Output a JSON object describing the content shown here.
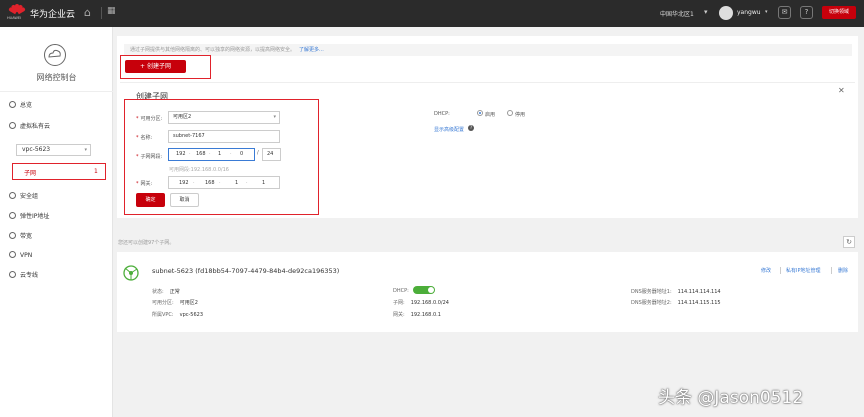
{
  "topbar": {
    "brand": "华为企业云",
    "logo_text": "HUAWEI",
    "region": "中国华北区1",
    "user": "yangwu",
    "red_button": "切换领域"
  },
  "sidebar": {
    "title": "网络控制台",
    "items": [
      {
        "label": "总览",
        "icon": "overview-icon"
      },
      {
        "label": "虚拟私有云",
        "icon": "vpc-icon"
      },
      {
        "label": "安全组",
        "icon": "security-group-icon"
      },
      {
        "label": "弹性IP地址",
        "icon": "eip-icon"
      },
      {
        "label": "带宽",
        "icon": "bandwidth-icon"
      },
      {
        "label": "VPN",
        "icon": "vpn-icon"
      },
      {
        "label": "云专线",
        "icon": "direct-connect-icon"
      }
    ],
    "vpc_select": "vpc-5623",
    "subnet_label": "子网",
    "subnet_count": "1"
  },
  "main": {
    "info_text": "通过子网提供与其他网络隔离的、可以独享的网络资源，以提高网络安全。",
    "info_link": "了解更多...",
    "create_button": "创建子网",
    "form": {
      "title": "创建子网",
      "az_label": "可用分区:",
      "az_value": "可用区2",
      "name_label": "名称:",
      "name_value": "subnet-7167",
      "cidr_label": "子网网段:",
      "cidr": [
        "192",
        "168",
        "1",
        "0"
      ],
      "cidr_mask": "24",
      "cidr_hint": "可用网段:192.168.0.0/16",
      "gateway_label": "网关:",
      "gateway": [
        "192",
        "168",
        "1",
        "1"
      ],
      "dhcp_label": "DHCP:",
      "dhcp_on": "启用",
      "dhcp_off": "停用",
      "advanced_link": "显示高级配置",
      "ok_button": "确定",
      "cancel_button": "取消"
    },
    "list_count_text": "您还可以创建97个子网。",
    "subnet_row": {
      "name": "subnet-5623",
      "id": "(fd18bb54-7097-4479-84b4-de92ca196353)",
      "status_label": "状态:",
      "status_value": "正常",
      "az_label": "可用分区:",
      "az_value": "可用区2",
      "vpc_label": "所属VPC:",
      "vpc_value": "vpc-5623",
      "dhcp_label": "DHCP:",
      "dhcp_enabled": true,
      "cidr_label": "子网:",
      "cidr_value": "192.168.0.0/24",
      "gateway_label": "网关:",
      "gateway_value": "192.168.0.1",
      "dns1_label": "DNS服务器地址1:",
      "dns1_value": "114.114.114.114",
      "dns2_label": "DNS服务器地址2:",
      "dns2_value": "114.114.115.115",
      "actions": [
        "修改",
        "私有IP地址管理",
        "删除"
      ]
    }
  },
  "watermark": "头条 @Jason0512",
  "colors": {
    "brand_red": "#c7000b",
    "link_blue": "#3a7bd5",
    "toggle_green": "#4cae3a"
  }
}
